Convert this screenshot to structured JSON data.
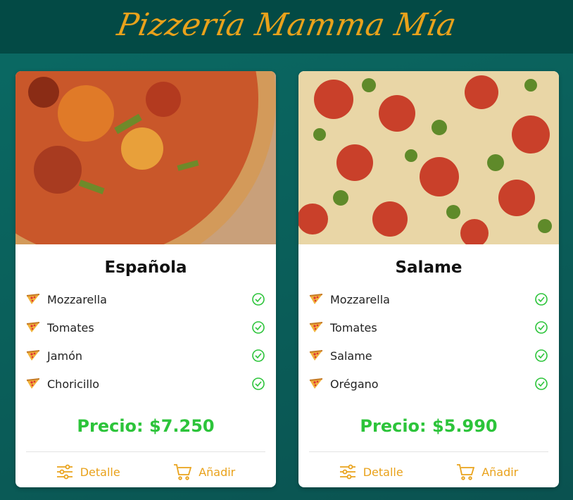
{
  "header": {
    "brand": "Pizzería Mamma Mía"
  },
  "colors": {
    "brand": "#e9a21b",
    "header_bg": "#034a45",
    "price": "#2cc43a",
    "check": "#2cc43a"
  },
  "cards": [
    {
      "image_alt": "pizza-espanola-photo",
      "title": "Española",
      "ingredients": [
        "Mozzarella",
        "Tomates",
        "Jamón",
        "Choricillo"
      ],
      "price": "Precio: $7.250",
      "detail_label": "Detalle",
      "add_label": "Añadir"
    },
    {
      "image_alt": "pizza-salame-photo",
      "title": "Salame",
      "ingredients": [
        "Mozzarella",
        "Tomates",
        "Salame",
        "Orégano"
      ],
      "price": "Precio: $5.990",
      "detail_label": "Detalle",
      "add_label": "Añadir"
    }
  ],
  "icons": {
    "ingredient": "pizza-slice-icon",
    "checked": "check-badge-icon",
    "detail": "sliders-icon",
    "add": "cart-icon"
  }
}
